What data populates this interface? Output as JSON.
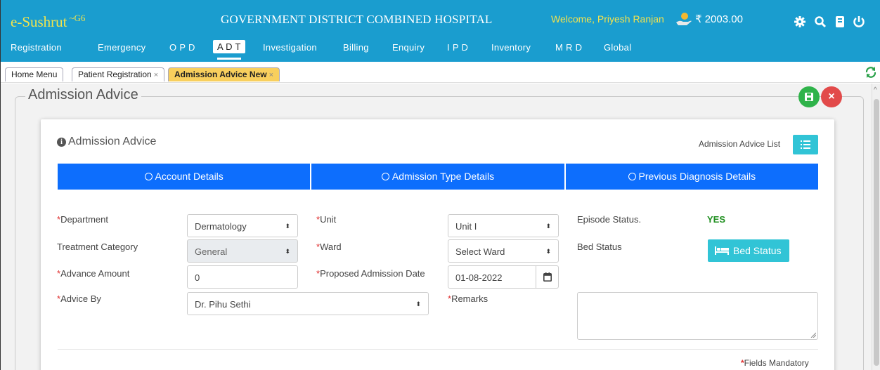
{
  "header": {
    "brand": "e-Sushrut",
    "brand_sup": "~G6",
    "hospital": "GOVERNMENT DISTRICT COMBINED HOSPITAL",
    "welcome": "Welcome, Priyesh Ranjan",
    "balance": "₹ 2003.00",
    "icons": [
      "coin-hand-icon",
      "gear-icon",
      "search-icon",
      "book-icon",
      "power-icon"
    ]
  },
  "nav": {
    "items": [
      "Registration",
      "Emergency",
      "O P D",
      "A D T",
      "Investigation",
      "Billing",
      "Enquiry",
      "I P D",
      "Inventory",
      "M R D",
      "Global"
    ],
    "active": "A D T"
  },
  "tabs": {
    "items": [
      {
        "label": "Home Menu",
        "closable": false
      },
      {
        "label": "Patient Registration",
        "closable": true
      },
      {
        "label": "Admission Advice New",
        "closable": true
      }
    ],
    "close_glyph": "×"
  },
  "page": {
    "legend": "Admission Advice",
    "save_icon": "save-icon",
    "close_glyph": "×"
  },
  "card": {
    "title": "Admission Advice",
    "list_label": "Admission Advice List",
    "sections": [
      "Account Details",
      "Admission Type Details",
      "Previous Diagnosis Details"
    ]
  },
  "form": {
    "department_label": "Department",
    "department_value": "Dermatology",
    "unit_label": "Unit",
    "unit_value": "Unit I",
    "episode_label": "Episode Status.",
    "episode_value": "YES",
    "treatment_label": "Treatment Category",
    "treatment_value": "General",
    "ward_label": "Ward",
    "ward_value": "Select Ward",
    "bed_status_label": "Bed Status",
    "bed_status_button": "Bed Status",
    "advance_label": "Advance Amount",
    "advance_value": "0",
    "proposed_label": "Proposed Admission Date",
    "proposed_value": "01-08-2022",
    "advice_label": "Advice By",
    "advice_value": "Dr. Pihu Sethi",
    "remarks_label": "Remarks",
    "remarks_value": "",
    "required_mark": "*",
    "mandatory_note": "Fields Mandatory"
  },
  "colors": {
    "header_blue": "#1a9dcf",
    "section_blue": "#0d6efd",
    "teal_button": "#31c4d6",
    "brand_yellow": "#f2e44d",
    "active_tab": "#f8cf5d",
    "save_green": "#2fb34a",
    "close_red": "#e24a4a",
    "status_green": "#1f8f1f"
  }
}
